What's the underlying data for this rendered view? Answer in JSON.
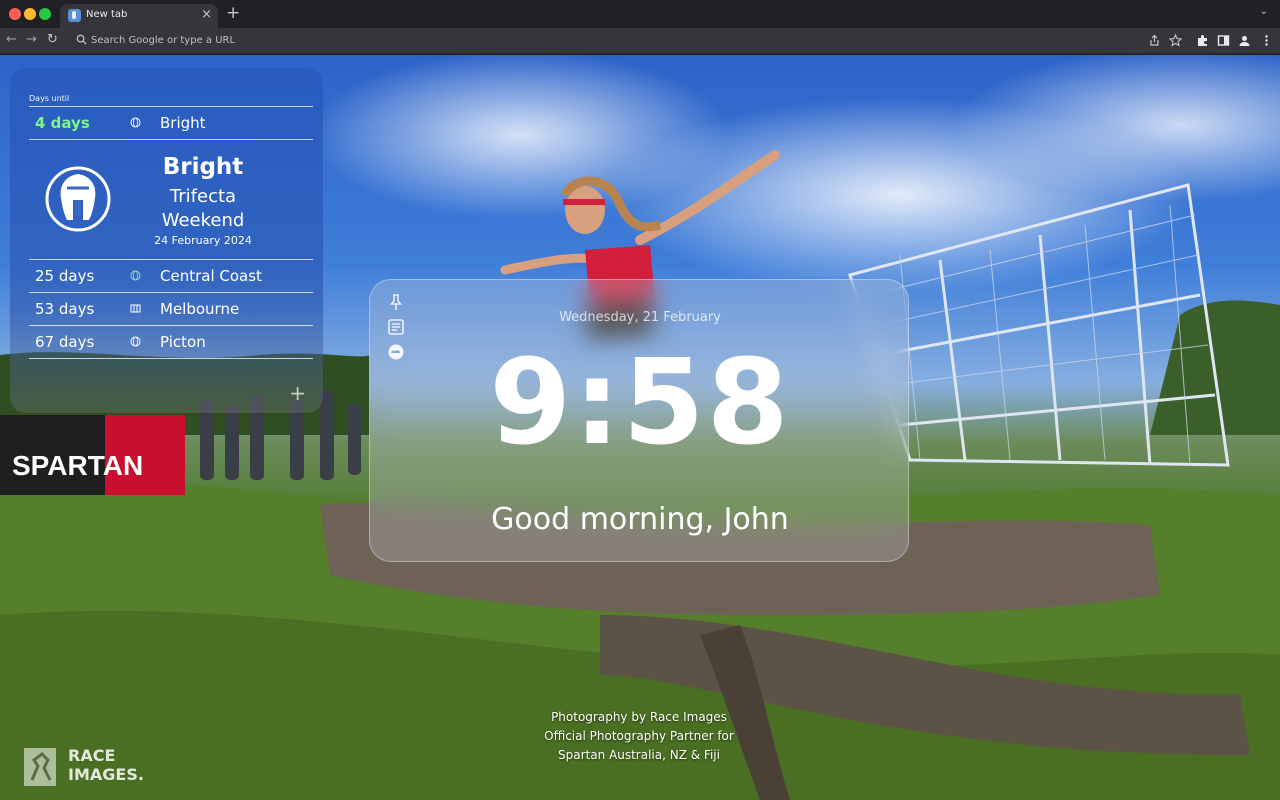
{
  "browser": {
    "tab_title": "New tab",
    "tab_close": "×",
    "new_tab": "+",
    "tab_menu": "⌄",
    "omnibox_placeholder": "Search Google or type a URL",
    "nav": {
      "back": "←",
      "forward": "→",
      "reload": "↻"
    },
    "toolbar_icons": [
      "share-icon",
      "bookmark-star-icon",
      "extensions-icon",
      "side-panel-icon",
      "profile-icon",
      "menu-icon"
    ]
  },
  "countdown": {
    "header": "Days until",
    "next": {
      "days": "4 days",
      "place": "Bright",
      "icon": "globe-icon"
    },
    "featured": {
      "name": "Bright",
      "line1": "Trifecta",
      "line2": "Weekend",
      "date": "24 February 2024",
      "logo": "spartan-helmet-icon"
    },
    "upcoming": [
      {
        "days": "25 days",
        "place": "Central Coast",
        "icon": "globe-icon"
      },
      {
        "days": "53 days",
        "place": "Melbourne",
        "icon": "stadium-icon"
      },
      {
        "days": "67 days",
        "place": "Picton",
        "icon": "globe-icon"
      }
    ],
    "add_label": "+"
  },
  "clock": {
    "date": "Wednesday, 21 February",
    "time": "9:58",
    "greeting": "Good morning, John",
    "side_icons": [
      "pin-icon",
      "notes-icon",
      "weather-icon"
    ]
  },
  "credits": {
    "line1": "Photography by Race Images",
    "line2": "Official Photography Partner for",
    "line3": "Spartan Australia, NZ & Fiji",
    "logo_line1": "RACE",
    "logo_line2": "IMAGES."
  },
  "banner_text": "SPARTAN"
}
